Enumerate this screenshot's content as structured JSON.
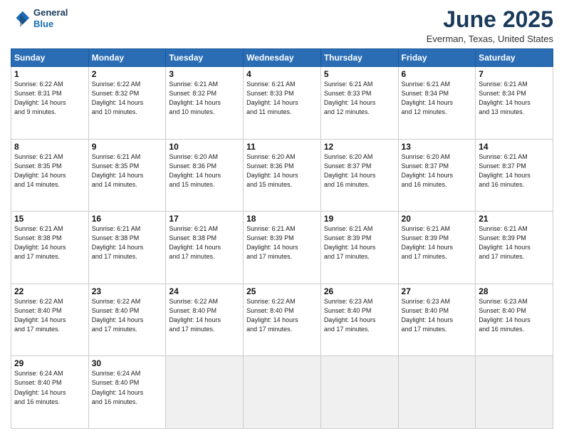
{
  "logo": {
    "line1": "General",
    "line2": "Blue"
  },
  "title": "June 2025",
  "location": "Everman, Texas, United States",
  "weekdays": [
    "Sunday",
    "Monday",
    "Tuesday",
    "Wednesday",
    "Thursday",
    "Friday",
    "Saturday"
  ],
  "weeks": [
    [
      {
        "day": "1",
        "info": "Sunrise: 6:22 AM\nSunset: 8:31 PM\nDaylight: 14 hours\nand 9 minutes."
      },
      {
        "day": "2",
        "info": "Sunrise: 6:22 AM\nSunset: 8:32 PM\nDaylight: 14 hours\nand 10 minutes."
      },
      {
        "day": "3",
        "info": "Sunrise: 6:21 AM\nSunset: 8:32 PM\nDaylight: 14 hours\nand 10 minutes."
      },
      {
        "day": "4",
        "info": "Sunrise: 6:21 AM\nSunset: 8:33 PM\nDaylight: 14 hours\nand 11 minutes."
      },
      {
        "day": "5",
        "info": "Sunrise: 6:21 AM\nSunset: 8:33 PM\nDaylight: 14 hours\nand 12 minutes."
      },
      {
        "day": "6",
        "info": "Sunrise: 6:21 AM\nSunset: 8:34 PM\nDaylight: 14 hours\nand 12 minutes."
      },
      {
        "day": "7",
        "info": "Sunrise: 6:21 AM\nSunset: 8:34 PM\nDaylight: 14 hours\nand 13 minutes."
      }
    ],
    [
      {
        "day": "8",
        "info": "Sunrise: 6:21 AM\nSunset: 8:35 PM\nDaylight: 14 hours\nand 14 minutes."
      },
      {
        "day": "9",
        "info": "Sunrise: 6:21 AM\nSunset: 8:35 PM\nDaylight: 14 hours\nand 14 minutes."
      },
      {
        "day": "10",
        "info": "Sunrise: 6:20 AM\nSunset: 8:36 PM\nDaylight: 14 hours\nand 15 minutes."
      },
      {
        "day": "11",
        "info": "Sunrise: 6:20 AM\nSunset: 8:36 PM\nDaylight: 14 hours\nand 15 minutes."
      },
      {
        "day": "12",
        "info": "Sunrise: 6:20 AM\nSunset: 8:37 PM\nDaylight: 14 hours\nand 16 minutes."
      },
      {
        "day": "13",
        "info": "Sunrise: 6:20 AM\nSunset: 8:37 PM\nDaylight: 14 hours\nand 16 minutes."
      },
      {
        "day": "14",
        "info": "Sunrise: 6:21 AM\nSunset: 8:37 PM\nDaylight: 14 hours\nand 16 minutes."
      }
    ],
    [
      {
        "day": "15",
        "info": "Sunrise: 6:21 AM\nSunset: 8:38 PM\nDaylight: 14 hours\nand 17 minutes."
      },
      {
        "day": "16",
        "info": "Sunrise: 6:21 AM\nSunset: 8:38 PM\nDaylight: 14 hours\nand 17 minutes."
      },
      {
        "day": "17",
        "info": "Sunrise: 6:21 AM\nSunset: 8:38 PM\nDaylight: 14 hours\nand 17 minutes."
      },
      {
        "day": "18",
        "info": "Sunrise: 6:21 AM\nSunset: 8:39 PM\nDaylight: 14 hours\nand 17 minutes."
      },
      {
        "day": "19",
        "info": "Sunrise: 6:21 AM\nSunset: 8:39 PM\nDaylight: 14 hours\nand 17 minutes."
      },
      {
        "day": "20",
        "info": "Sunrise: 6:21 AM\nSunset: 8:39 PM\nDaylight: 14 hours\nand 17 minutes."
      },
      {
        "day": "21",
        "info": "Sunrise: 6:21 AM\nSunset: 8:39 PM\nDaylight: 14 hours\nand 17 minutes."
      }
    ],
    [
      {
        "day": "22",
        "info": "Sunrise: 6:22 AM\nSunset: 8:40 PM\nDaylight: 14 hours\nand 17 minutes."
      },
      {
        "day": "23",
        "info": "Sunrise: 6:22 AM\nSunset: 8:40 PM\nDaylight: 14 hours\nand 17 minutes."
      },
      {
        "day": "24",
        "info": "Sunrise: 6:22 AM\nSunset: 8:40 PM\nDaylight: 14 hours\nand 17 minutes."
      },
      {
        "day": "25",
        "info": "Sunrise: 6:22 AM\nSunset: 8:40 PM\nDaylight: 14 hours\nand 17 minutes."
      },
      {
        "day": "26",
        "info": "Sunrise: 6:23 AM\nSunset: 8:40 PM\nDaylight: 14 hours\nand 17 minutes."
      },
      {
        "day": "27",
        "info": "Sunrise: 6:23 AM\nSunset: 8:40 PM\nDaylight: 14 hours\nand 17 minutes."
      },
      {
        "day": "28",
        "info": "Sunrise: 6:23 AM\nSunset: 8:40 PM\nDaylight: 14 hours\nand 16 minutes."
      }
    ],
    [
      {
        "day": "29",
        "info": "Sunrise: 6:24 AM\nSunset: 8:40 PM\nDaylight: 14 hours\nand 16 minutes."
      },
      {
        "day": "30",
        "info": "Sunrise: 6:24 AM\nSunset: 8:40 PM\nDaylight: 14 hours\nand 16 minutes."
      },
      {
        "day": "",
        "info": ""
      },
      {
        "day": "",
        "info": ""
      },
      {
        "day": "",
        "info": ""
      },
      {
        "day": "",
        "info": ""
      },
      {
        "day": "",
        "info": ""
      }
    ]
  ]
}
